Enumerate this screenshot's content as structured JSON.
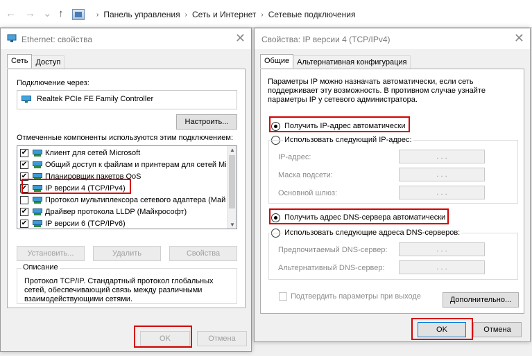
{
  "addressbar": {
    "back": "←",
    "forward": "→",
    "up": "↑",
    "crumbs": [
      "Панель управления",
      "Сеть и Интернет",
      "Сетевые подключения"
    ]
  },
  "eth": {
    "title": "Ethernet: свойства",
    "tabs": [
      "Сеть",
      "Доступ"
    ],
    "connect_using_label": "Подключение через:",
    "adapter": "Realtek PCIe FE Family Controller",
    "configure_btn": "Настроить...",
    "components_label": "Отмеченные компоненты используются этим подключением:",
    "components": [
      {
        "label": "Клиент для сетей Microsoft",
        "checked": true
      },
      {
        "label": "Общий доступ к файлам и принтерам для сетей Mi",
        "checked": true
      },
      {
        "label": "Планировщик пакетов QoS",
        "checked": true
      },
      {
        "label": "IP версии 4 (TCP/IPv4)",
        "checked": true
      },
      {
        "label": "Протокол мультиплексора сетевого адаптера (Май",
        "checked": false
      },
      {
        "label": "Драйвер протокола LLDP (Майкрософт)",
        "checked": true
      },
      {
        "label": "IP версии 6 (TCP/IPv6)",
        "checked": true
      }
    ],
    "install_btn": "Установить...",
    "remove_btn": "Удалить",
    "props_btn": "Свойства",
    "description_title": "Описание",
    "description": "Протокол TCP/IP. Стандартный протокол глобальных сетей, обеспечивающий связь между различными взаимодействующими сетями.",
    "ok": "OK",
    "cancel": "Отмена"
  },
  "ipv4": {
    "title": "Свойства: IP версии 4 (TCP/IPv4)",
    "tabs": [
      "Общие",
      "Альтернативная конфигурация"
    ],
    "intro": "Параметры IP можно назначать автоматически, если сеть поддерживает эту возможность. В противном случае узнайте параметры IP у сетевого администратора.",
    "auto_ip": "Получить IP-адрес автоматически",
    "manual_ip": "Использовать следующий IP-адрес:",
    "ip_label": "IP-адрес:",
    "mask_label": "Маска подсети:",
    "gateway_label": "Основной шлюз:",
    "auto_dns": "Получить адрес DNS-сервера автоматически",
    "manual_dns": "Использовать следующие адреса DNS-серверов:",
    "pref_dns_label": "Предпочитаемый DNS-сервер:",
    "alt_dns_label": "Альтернативный DNS-сервер:",
    "validate_label": "Подтвердить параметры при выходе",
    "advanced_btn": "Дополнительно...",
    "ok": "OK",
    "cancel": "Отмена",
    "ip_dots": ". . ."
  },
  "colors": {
    "highlight": "#d40000",
    "accent": "#0063b1"
  }
}
